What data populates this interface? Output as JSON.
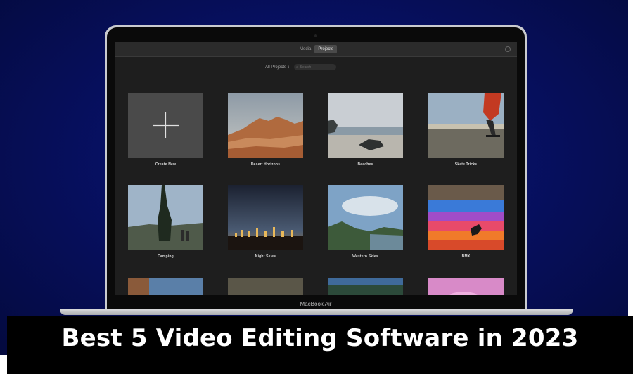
{
  "app": {
    "tabs": [
      {
        "label": "Media",
        "active": false
      },
      {
        "label": "Projects",
        "active": true
      }
    ],
    "filter_label": "All Projects ↕",
    "search_placeholder": "Search"
  },
  "projects": [
    {
      "name": "Create New",
      "kind": "create"
    },
    {
      "name": "Desert Horizons",
      "kind": "desert"
    },
    {
      "name": "Beaches",
      "kind": "beach"
    },
    {
      "name": "Skate Tricks",
      "kind": "skate"
    },
    {
      "name": "Camping",
      "kind": "camping"
    },
    {
      "name": "Night Skies",
      "kind": "night"
    },
    {
      "name": "Western Skies",
      "kind": "western"
    },
    {
      "name": "BMX",
      "kind": "bmx"
    }
  ],
  "device_label": "MacBook Air",
  "banner_title": "Best 5 Video Editing Software in 2023",
  "colors": {
    "background": "#071063",
    "screen": "#1e1e1e",
    "banner": "#000000"
  }
}
